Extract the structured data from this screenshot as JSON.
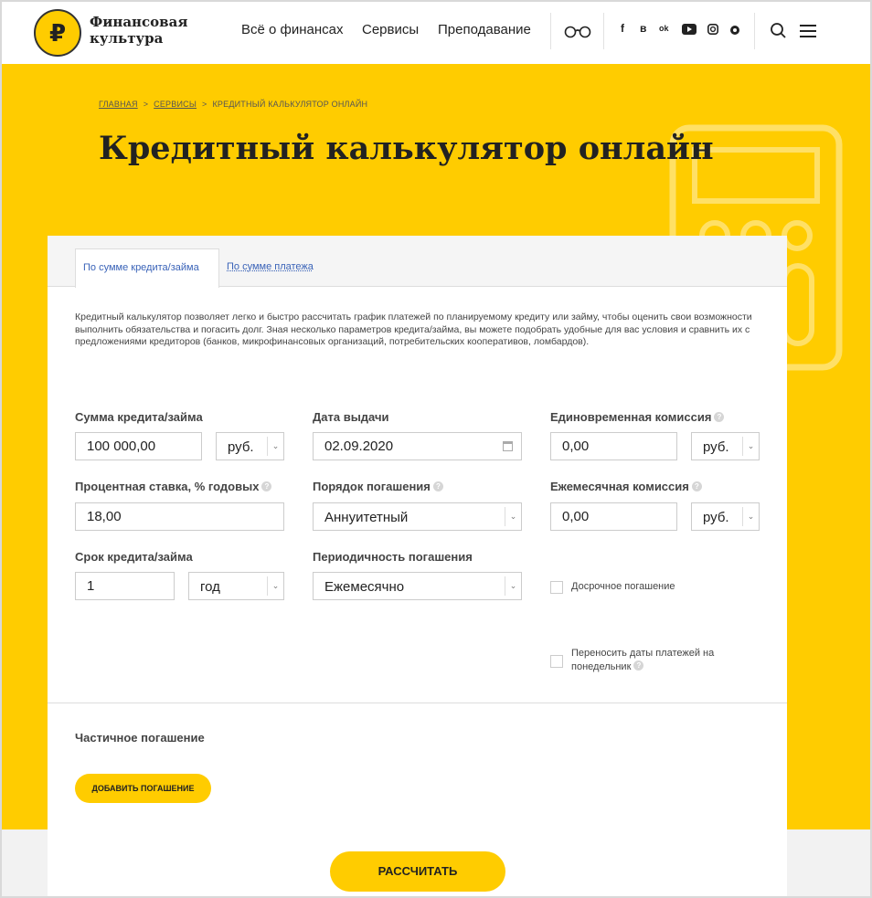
{
  "header": {
    "logo_symbol": "₽",
    "logo_text_1": "Финансовая",
    "logo_text_2": "культура",
    "nav": [
      "Всё о финансах",
      "Сервисы",
      "Преподавание"
    ],
    "social": [
      "f",
      "в",
      "ok",
      "yt",
      "ig",
      "lj"
    ]
  },
  "breadcrumb": {
    "home": "ГЛАВНАЯ",
    "services": "СЕРВИСЫ",
    "current": "КРЕДИТНЫЙ КАЛЬКУЛЯТОР ОНЛАЙН",
    "separator": ">"
  },
  "page_title": "Кредитный калькулятор онлайн",
  "tabs": {
    "by_amount": "По сумме кредита/займа",
    "by_payment": "По сумме платежа"
  },
  "description": "Кредитный калькулятор позволяет легко и быстро рассчитать график платежей по планируемому кредиту или займу, чтобы оценить свои возможности выполнить обязательства и погасить долг. Зная несколько параметров кредита/займа, вы можете подобрать удобные для вас условия и сравнить их с предложениями кредиторов (банков, микрофинансовых организаций, потребительских кооперативов, ломбардов).",
  "form": {
    "amount": {
      "label": "Сумма кредита/займа",
      "value": "100 000,00",
      "currency": "руб."
    },
    "rate": {
      "label": "Процентная ставка, % годовых",
      "value": "18,00"
    },
    "term": {
      "label": "Срок кредита/займа",
      "value": "1",
      "unit": "год"
    },
    "issue_date": {
      "label": "Дата выдачи",
      "value": "02.09.2020"
    },
    "repayment_order": {
      "label": "Порядок погашения",
      "value": "Аннуитетный"
    },
    "periodicity": {
      "label": "Периодичность погашения",
      "value": "Ежемесячно"
    },
    "one_time_fee": {
      "label": "Единовременная комиссия",
      "value": "0,00",
      "currency": "руб."
    },
    "monthly_fee": {
      "label": "Ежемесячная комиссия",
      "value": "0,00",
      "currency": "руб."
    },
    "early_repayment": {
      "label": "Досрочное погашение",
      "checked": false
    },
    "move_dates": {
      "label_1": "Переносить даты платежей на",
      "label_2": "понедельник",
      "checked": false
    }
  },
  "partial": {
    "title": "Частичное погашение",
    "add_button": "ДОБАВИТЬ ПОГАШЕНИЕ"
  },
  "calculate_button": "РАССЧИТАТЬ",
  "colors": {
    "accent": "#ffcc00",
    "link": "#3a63b8"
  }
}
